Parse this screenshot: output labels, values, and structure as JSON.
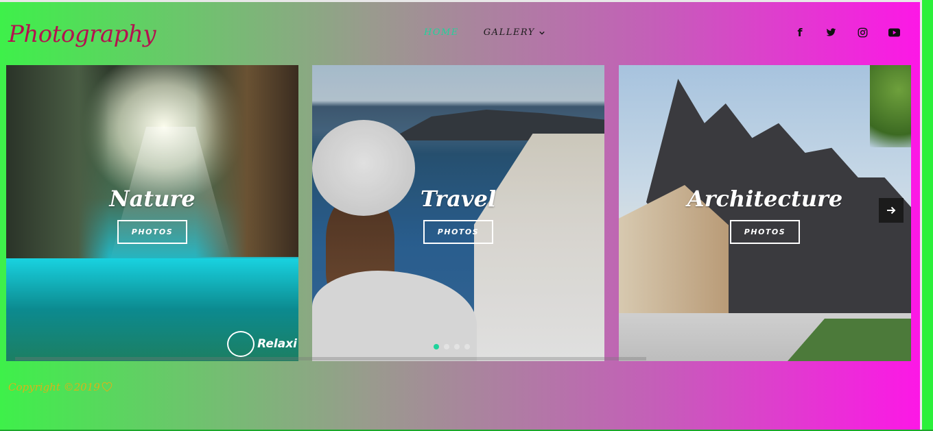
{
  "logo": "Photography",
  "nav": {
    "home": "HOME",
    "gallery": "GALLERY"
  },
  "social": {
    "facebook": "f",
    "icons": [
      "facebook-icon",
      "twitter-icon",
      "instagram-icon",
      "youtube-icon"
    ]
  },
  "cards": [
    {
      "title": "Nature",
      "button": "PHOTOS"
    },
    {
      "title": "Travel",
      "button": "PHOTOS"
    },
    {
      "title": "Architecture",
      "button": "PHOTOS"
    }
  ],
  "watermark": "Relaxi",
  "carousel": {
    "dot_count": 4,
    "active_dot": 1
  },
  "footer": {
    "copyright": "Copyright ©2019"
  },
  "colors": {
    "accent": "#1fd39b",
    "logo": "#b3124f",
    "copyright": "#d9b21a"
  }
}
